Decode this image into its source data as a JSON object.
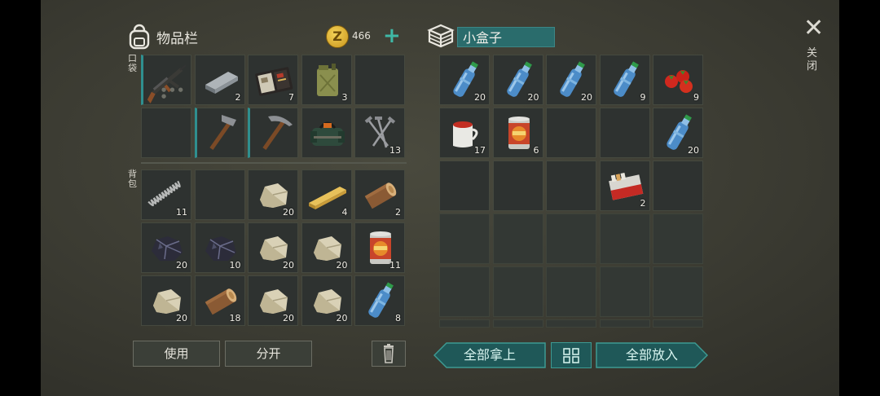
{
  "inventory": {
    "title": "物品栏",
    "coins": "466",
    "plus_label": "+",
    "pocket_label": "口袋",
    "backpack_label": "背包",
    "pocket_slots": [
      {
        "item": "rifle",
        "count": "",
        "equip": true
      },
      {
        "item": "metal-bar",
        "count": "2"
      },
      {
        "item": "wallet",
        "count": "7"
      },
      {
        "item": "jerrycan",
        "count": "3"
      },
      {
        "item": "",
        "count": ""
      },
      {
        "item": "",
        "count": ""
      },
      {
        "item": "hammer",
        "count": "",
        "equip": true
      },
      {
        "item": "pickaxe",
        "count": "",
        "equip": true
      },
      {
        "item": "tool-bag",
        "count": ""
      },
      {
        "item": "nails",
        "count": "13"
      }
    ],
    "backpack_slots": [
      {
        "item": "spring",
        "count": "11"
      },
      {
        "item": "",
        "count": ""
      },
      {
        "item": "stone",
        "count": "20"
      },
      {
        "item": "plank",
        "count": "4"
      },
      {
        "item": "log",
        "count": "2"
      },
      {
        "item": "coal",
        "count": "20"
      },
      {
        "item": "coal",
        "count": "10"
      },
      {
        "item": "stone",
        "count": "20"
      },
      {
        "item": "stone",
        "count": "20"
      },
      {
        "item": "canned-food",
        "count": "11"
      },
      {
        "item": "stone",
        "count": "20"
      },
      {
        "item": "log",
        "count": "18"
      },
      {
        "item": "stone",
        "count": "20"
      },
      {
        "item": "stone",
        "count": "20"
      },
      {
        "item": "water-bottle",
        "count": "8"
      }
    ],
    "use_label": "使用",
    "split_label": "分开"
  },
  "box": {
    "name": "小盒子",
    "slots": [
      {
        "item": "water-bottle",
        "count": "20"
      },
      {
        "item": "water-bottle",
        "count": "20"
      },
      {
        "item": "water-bottle",
        "count": "20"
      },
      {
        "item": "water-bottle",
        "count": "9"
      },
      {
        "item": "tomatoes",
        "count": "9"
      },
      {
        "item": "tea-mug",
        "count": "17"
      },
      {
        "item": "canned-food",
        "count": "6"
      },
      {
        "item": "",
        "count": ""
      },
      {
        "item": "",
        "count": ""
      },
      {
        "item": "water-bottle",
        "count": "20"
      },
      {
        "item": "",
        "count": ""
      },
      {
        "item": "",
        "count": ""
      },
      {
        "item": "",
        "count": ""
      },
      {
        "item": "cigarettes",
        "count": "2"
      },
      {
        "item": "",
        "count": ""
      }
    ],
    "take_all_label": "全部拿上",
    "put_all_label": "全部放入"
  },
  "close_label": "关闭",
  "colors": {
    "accent": "#2a6c6c",
    "teal_text": "#3fb8a6",
    "slot_bg": "#2e3230"
  }
}
